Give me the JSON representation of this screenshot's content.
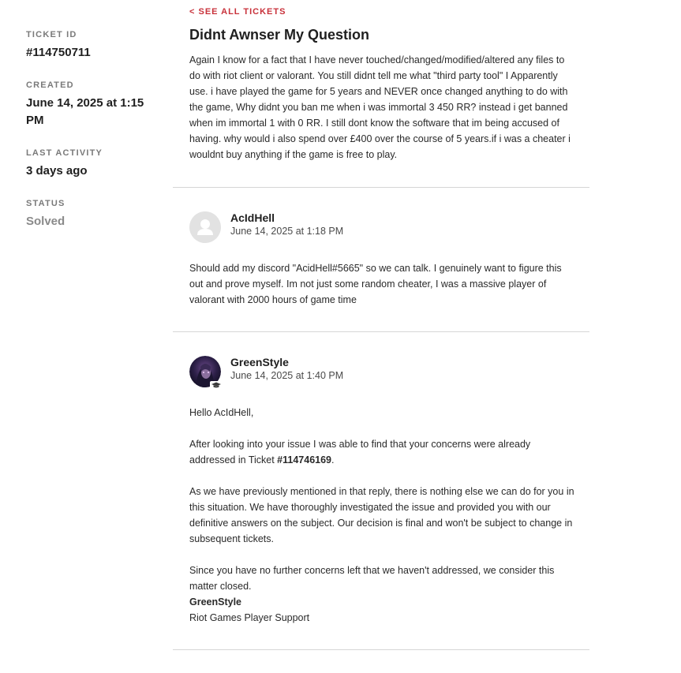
{
  "sidebar": {
    "ticket_id_label": "TICKET ID",
    "ticket_id": "#114750711",
    "created_label": "CREATED",
    "created": "June 14, 2025 at 1:15 PM",
    "last_activity_label": "LAST ACTIVITY",
    "last_activity": "3 days ago",
    "status_label": "STATUS",
    "status": "Solved"
  },
  "header": {
    "back_link": "< SEE ALL TICKETS",
    "title": "Didnt Awnser My Question"
  },
  "description": "Again I know for a fact that I have never touched/changed/modified/altered any files to do with riot client or valorant. You still didnt tell me what \"third party tool\" I Apparently use. i have played the game for 5 years and NEVER once changed anything to do with the game, Why didnt you ban me when i was immortal 3 450 RR? instead i get banned when im immortal 1 with 0 RR. I still dont know the software that im being accused of having. why would i also spend over £400 over the course of 5 years.if i was a cheater i wouldnt buy anything if the game is free to play.",
  "comments": [
    {
      "author": "AcIdHell",
      "date": "June 14, 2025 at 1:18 PM",
      "body": "Should add my discord \"AcidHell#5665\" so we can talk. I genuinely want to figure this out and prove myself. Im not just some random cheater, I was a massive player of valorant with 2000 hours of game time",
      "avatar_icon": "user-silhouette-icon"
    },
    {
      "author": "GreenStyle",
      "date": "June 14, 2025 at 1:40 PM",
      "avatar_icon": "agent-avatar",
      "badge_icon": "graduation-cap-icon",
      "greeting": "Hello AcIdHell,",
      "p1_prefix": "After looking into your issue I was able to find that your concerns were already addressed in Ticket ",
      "p1_ticket": "#114746169",
      "p1_suffix": ".",
      "p2": "As we have previously mentioned in that reply, there is nothing else we can do for you in this situation. We have thoroughly investigated the issue and provided you with our definitive answers on the subject. Our decision is final and won't be subject to change in subsequent tickets.",
      "p3": "Since you have no further concerns left that we haven't addressed, we consider this matter closed.",
      "signature_name": "GreenStyle",
      "signature_team": "Riot Games Player Support"
    }
  ],
  "colors": {
    "accent": "#c8313a",
    "divider": "#d6d6d6",
    "muted": "#8a8a8a"
  }
}
